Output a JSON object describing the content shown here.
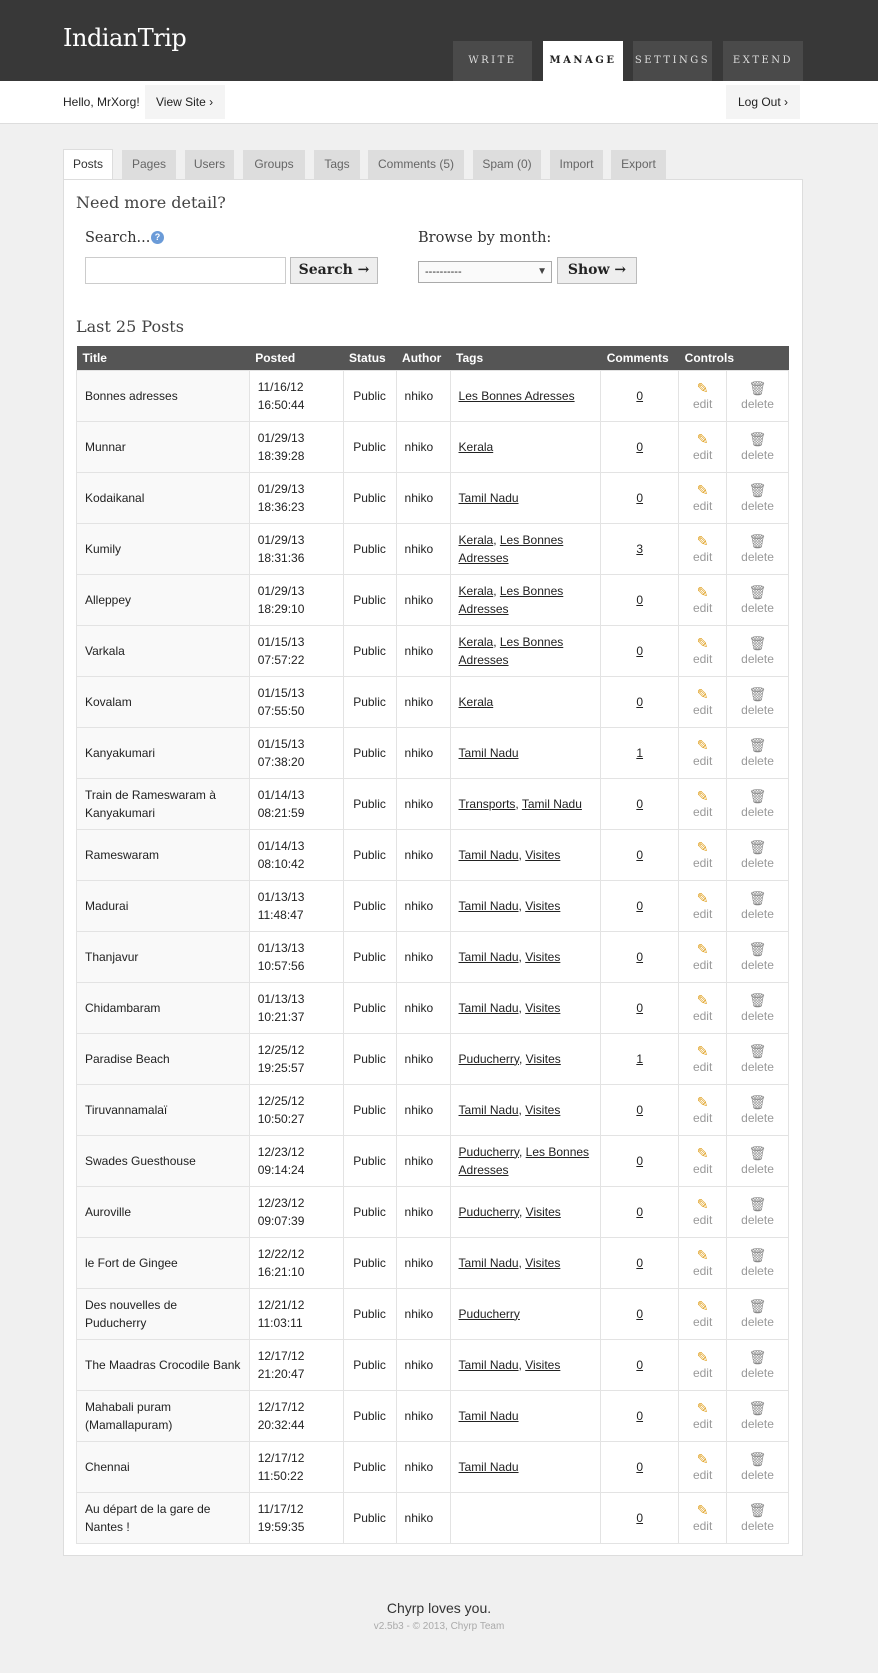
{
  "site": {
    "title": "IndianTrip"
  },
  "nav": [
    {
      "label": "WRITE",
      "active": false
    },
    {
      "label": "MANAGE",
      "active": true
    },
    {
      "label": "SETTINGS",
      "active": false
    },
    {
      "label": "EXTEND",
      "active": false
    }
  ],
  "user": {
    "greeting": "Hello, MrXorg!",
    "view_site": "View Site ›",
    "logout": "Log Out ›"
  },
  "tabs": [
    "Posts",
    "Pages",
    "Users",
    "Groups",
    "Tags",
    "Comments (5)",
    "Spam (0)",
    "Import",
    "Export"
  ],
  "active_tab": "Posts",
  "search": {
    "heading": "Need more detail?",
    "label": "Search...",
    "help_icon": "?",
    "value": "",
    "button": "Search →",
    "browse_label": "Browse by month:",
    "month_selected": "----------",
    "show_button": "Show →"
  },
  "posts_heading": "Last 25 Posts",
  "columns": [
    "Title",
    "Posted",
    "Status",
    "Author",
    "Tags",
    "Comments",
    "Controls"
  ],
  "controls": {
    "edit": "edit",
    "delete": "delete"
  },
  "posts": [
    {
      "title": "Bonnes adresses",
      "date": "11/16/12",
      "time": "16:50:44",
      "status": "Public",
      "author": "nhiko",
      "tags": [
        "Les Bonnes Adresses"
      ],
      "comments": "0"
    },
    {
      "title": "Munnar",
      "date": "01/29/13",
      "time": "18:39:28",
      "status": "Public",
      "author": "nhiko",
      "tags": [
        "Kerala"
      ],
      "comments": "0"
    },
    {
      "title": "Kodaikanal",
      "date": "01/29/13",
      "time": "18:36:23",
      "status": "Public",
      "author": "nhiko",
      "tags": [
        "Tamil Nadu"
      ],
      "comments": "0"
    },
    {
      "title": "Kumily",
      "date": "01/29/13",
      "time": "18:31:36",
      "status": "Public",
      "author": "nhiko",
      "tags": [
        "Kerala",
        "Les Bonnes Adresses"
      ],
      "comments": "3"
    },
    {
      "title": "Alleppey",
      "date": "01/29/13",
      "time": "18:29:10",
      "status": "Public",
      "author": "nhiko",
      "tags": [
        "Kerala",
        "Les Bonnes Adresses"
      ],
      "comments": "0"
    },
    {
      "title": "Varkala",
      "date": "01/15/13",
      "time": "07:57:22",
      "status": "Public",
      "author": "nhiko",
      "tags": [
        "Kerala",
        "Les Bonnes Adresses"
      ],
      "comments": "0"
    },
    {
      "title": "Kovalam",
      "date": "01/15/13",
      "time": "07:55:50",
      "status": "Public",
      "author": "nhiko",
      "tags": [
        "Kerala"
      ],
      "comments": "0"
    },
    {
      "title": "Kanyakumari",
      "date": "01/15/13",
      "time": "07:38:20",
      "status": "Public",
      "author": "nhiko",
      "tags": [
        "Tamil Nadu"
      ],
      "comments": "1"
    },
    {
      "title": "Train de Rameswaram à Kanyakumari",
      "date": "01/14/13",
      "time": "08:21:59",
      "status": "Public",
      "author": "nhiko",
      "tags": [
        "Transports",
        "Tamil Nadu"
      ],
      "comments": "0"
    },
    {
      "title": "Rameswaram",
      "date": "01/14/13",
      "time": "08:10:42",
      "status": "Public",
      "author": "nhiko",
      "tags": [
        "Tamil Nadu",
        "Visites"
      ],
      "comments": "0"
    },
    {
      "title": "Madurai",
      "date": "01/13/13",
      "time": "11:48:47",
      "status": "Public",
      "author": "nhiko",
      "tags": [
        "Tamil Nadu",
        "Visites"
      ],
      "comments": "0"
    },
    {
      "title": "Thanjavur",
      "date": "01/13/13",
      "time": "10:57:56",
      "status": "Public",
      "author": "nhiko",
      "tags": [
        "Tamil Nadu",
        "Visites"
      ],
      "comments": "0"
    },
    {
      "title": "Chidambaram",
      "date": "01/13/13",
      "time": "10:21:37",
      "status": "Public",
      "author": "nhiko",
      "tags": [
        "Tamil Nadu",
        "Visites"
      ],
      "comments": "0"
    },
    {
      "title": "Paradise Beach",
      "date": "12/25/12",
      "time": "19:25:57",
      "status": "Public",
      "author": "nhiko",
      "tags": [
        "Puducherry",
        "Visites"
      ],
      "comments": "1"
    },
    {
      "title": "Tiruvannamalaï",
      "date": "12/25/12",
      "time": "10:50:27",
      "status": "Public",
      "author": "nhiko",
      "tags": [
        "Tamil Nadu",
        "Visites"
      ],
      "comments": "0"
    },
    {
      "title": "Swades Guesthouse",
      "date": "12/23/12",
      "time": "09:14:24",
      "status": "Public",
      "author": "nhiko",
      "tags": [
        "Puducherry",
        "Les Bonnes Adresses"
      ],
      "comments": "0"
    },
    {
      "title": "Auroville",
      "date": "12/23/12",
      "time": "09:07:39",
      "status": "Public",
      "author": "nhiko",
      "tags": [
        "Puducherry",
        "Visites"
      ],
      "comments": "0"
    },
    {
      "title": "le Fort de Gingee",
      "date": "12/22/12",
      "time": "16:21:10",
      "status": "Public",
      "author": "nhiko",
      "tags": [
        "Tamil Nadu",
        "Visites"
      ],
      "comments": "0"
    },
    {
      "title": "Des nouvelles de Puducherry",
      "date": "12/21/12",
      "time": "11:03:11",
      "status": "Public",
      "author": "nhiko",
      "tags": [
        "Puducherry"
      ],
      "comments": "0"
    },
    {
      "title": "The Maadras Crocodile Bank",
      "date": "12/17/12",
      "time": "21:20:47",
      "status": "Public",
      "author": "nhiko",
      "tags": [
        "Tamil Nadu",
        "Visites"
      ],
      "comments": "0"
    },
    {
      "title": "Mahabali puram (Mamallapuram)",
      "date": "12/17/12",
      "time": "20:32:44",
      "status": "Public",
      "author": "nhiko",
      "tags": [
        "Tamil Nadu"
      ],
      "comments": "0"
    },
    {
      "title": "Chennai",
      "date": "12/17/12",
      "time": "11:50:22",
      "status": "Public",
      "author": "nhiko",
      "tags": [
        "Tamil Nadu"
      ],
      "comments": "0"
    },
    {
      "title": "Au départ de la gare de Nantes !",
      "date": "11/17/12",
      "time": "19:59:35",
      "status": "Public",
      "author": "nhiko",
      "tags": [],
      "comments": "0"
    }
  ],
  "footer": {
    "tagline": "Chyrp loves you.",
    "version": "v2.5b3 - © 2013, Chyrp Team"
  }
}
